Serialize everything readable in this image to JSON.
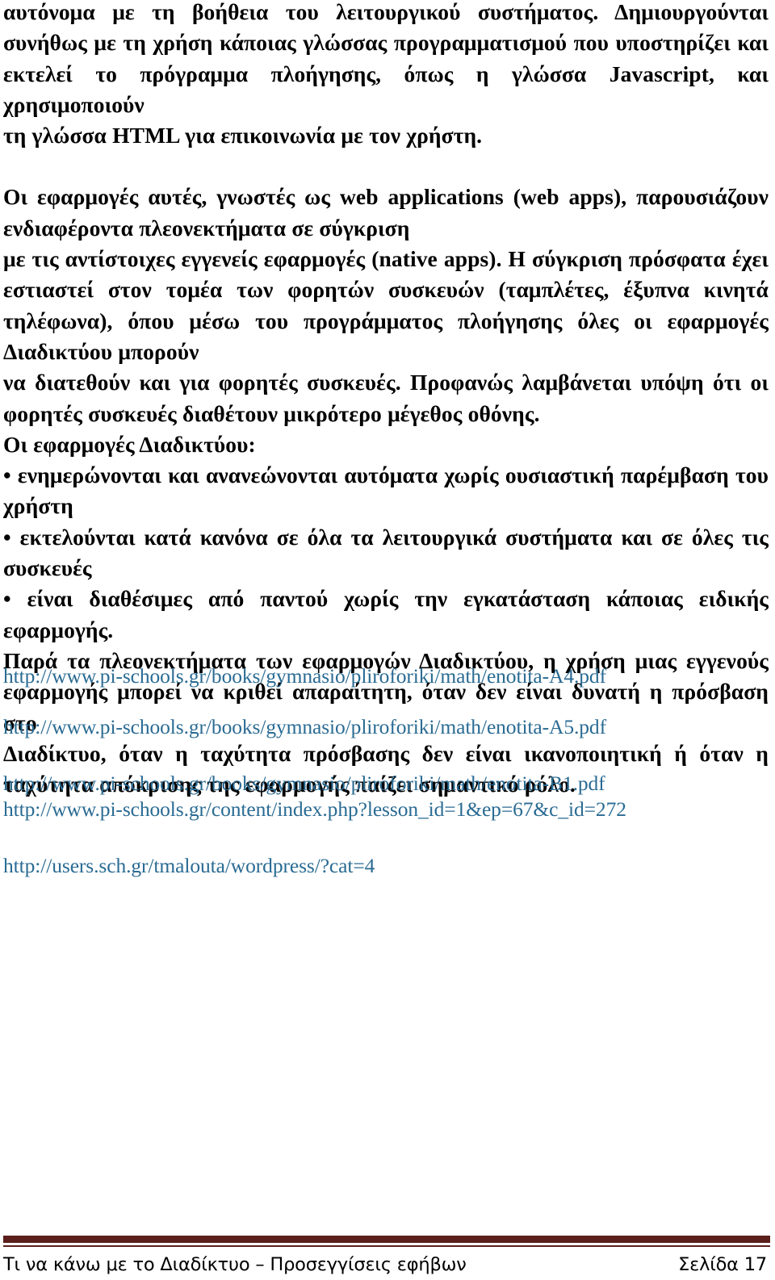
{
  "document": {
    "language": "el",
    "link_color": "#2a6b93",
    "footer_rule_color": "#5b1f1c",
    "text_color": "#000000",
    "background_color": "#ffffff"
  },
  "body": {
    "paragraphs": [
      {
        "id": "p1",
        "lines": [
          "αυτόνομα με τη βοήθεια του λειτουργικού συστήματος. Δημιουργούνται",
          "συνήθως με τη χρήση κάποιας γλώσσας προγραμματισμού που υποστηρίζει και",
          "εκτελεί το πρόγραμμα πλοήγησης, όπως η γλώσσα Javascript, και χρησιμοποιούν",
          "τη γλώσσα HTML για επικοινωνία με τον χρήστη."
        ]
      },
      {
        "id": "p2",
        "lines": [
          "Οι εφαρμογές αυτές, γνωστές ως web applications (web apps), παρουσιάζουν",
          "ενδιαφέροντα πλεονεκτήματα σε σύγκριση",
          "με τις αντίστοιχες εγγενείς εφαρμογές (native apps). Η σύγκριση πρόσφατα έχει",
          "εστιαστεί στον τομέα των φορητών συσκευών (ταμπλέτες, έξυπνα κινητά",
          "τηλέφωνα), όπου μέσω του προγράμματος πλοήγησης όλες οι εφαρμογές",
          "Διαδικτύου μπορούν",
          "να διατεθούν και για φορητές συσκευές. Προφανώς λαμβάνεται υπόψη ότι οι",
          "φορητές συσκευές διαθέτουν μικρότερο μέγεθος οθόνης.",
          "Οι εφαρμογές Διαδικτύου:",
          "• ενημερώνονται και ανανεώνονται αυτόματα χωρίς ουσιαστική παρέμβαση του",
          "χρήστη",
          "• εκτελούνται κατά κανόνα σε όλα τα λειτουργικά συστήματα και σε όλες τις",
          "συσκευές",
          "• είναι διαθέσιμες από παντού χωρίς την εγκατάσταση κάποιας ειδικής",
          "εφαρμογής.",
          "Παρά τα πλεονεκτήματα των εφαρμογών Διαδικτύου, η χρήση μιας εγγενούς",
          "εφαρμογής μπορεί να κριθεί απαραίτητη, όταν δεν είναι δυνατή η πρόσβαση στο",
          "Διαδίκτυο, όταν η ταχύτητα πρόσβασης δεν είναι ικανοποιητική ή όταν η",
          "ταχύτητα απόκρισης της εφαρμογής παίζει σημαντικό ρόλο."
        ]
      }
    ]
  },
  "links": [
    {
      "id": "link-1",
      "text": "http://www.pi-schools.gr/books/gymnasio/pliroforiki/math/enotita-A4.pdf"
    },
    {
      "id": "link-2",
      "text": "http://www.pi-schools.gr/books/gymnasio/pliroforiki/math/enotita-A5.pdf"
    },
    {
      "id": "link-3",
      "text": "http://www.pi-schools.gr/books/gymnasio/pliroforiki/math/enotita-B1.pdf"
    },
    {
      "id": "link-4",
      "text": "http://www.pi-schools.gr/content/index.php?lesson_id=1&ep=67&c_id=272"
    },
    {
      "id": "link-5",
      "text": "http://users.sch.gr/tmalouta/wordpress/?cat=4"
    }
  ],
  "footer": {
    "title": "Τι να κάνω με το Διαδίκτυο – Προσεγγίσεις εφήβων",
    "page_label": "Σελίδα 17"
  }
}
